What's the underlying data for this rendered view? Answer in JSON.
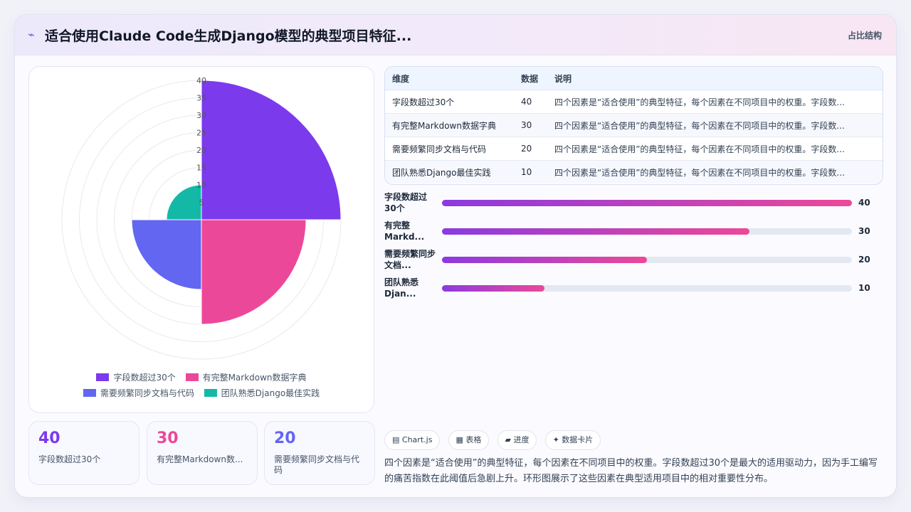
{
  "header": {
    "icon": "activity-icon",
    "title": "适合使用Claude Code生成Django模型的典型项目特征...",
    "tag": "占比结构"
  },
  "chart_data": {
    "type": "polarArea",
    "title": "",
    "categories": [
      "字段数超过30个",
      "有完整Markdown数据字典",
      "需要频繁同步文档与代码",
      "团队熟悉Django最佳实践"
    ],
    "values": [
      40,
      30,
      20,
      10
    ],
    "colors": [
      "#7c3aed",
      "#ec4899",
      "#6366f1",
      "#14b8a6"
    ],
    "rlim": [
      0,
      40
    ],
    "ticks": [
      40,
      35,
      30,
      25,
      20,
      15,
      10,
      5
    ],
    "grid": true,
    "legend": "bottom"
  },
  "legend": {
    "items": [
      {
        "label": "字段数超过30个",
        "color": "#7c3aed"
      },
      {
        "label": "有完整Markdown数据字典",
        "color": "#ec4899"
      },
      {
        "label": "需要频繁同步文档与代码",
        "color": "#6366f1"
      },
      {
        "label": "团队熟悉Django最佳实践",
        "color": "#14b8a6"
      }
    ]
  },
  "stats": [
    {
      "value": "40",
      "label": "字段数超过30个",
      "color": "#7c3aed"
    },
    {
      "value": "30",
      "label": "有完整Markdown数...",
      "color": "#ec4899"
    },
    {
      "value": "20",
      "label": "需要频繁同步文档与代码",
      "color": "#6366f1"
    }
  ],
  "table": {
    "headers": [
      "维度",
      "数据",
      "说明"
    ],
    "rows": [
      [
        "字段数超过30个",
        "40",
        "四个因素是“适合使用”的典型特征，每个因素在不同项目中的权重。字段数..."
      ],
      [
        "有完整Markdown数据字典",
        "30",
        "四个因素是“适合使用”的典型特征，每个因素在不同项目中的权重。字段数..."
      ],
      [
        "需要频繁同步文档与代码",
        "20",
        "四个因素是“适合使用”的典型特征，每个因素在不同项目中的权重。字段数..."
      ],
      [
        "团队熟悉Django最佳实践",
        "10",
        "四个因素是“适合使用”的典型特征，每个因素在不同项目中的权重。字段数..."
      ]
    ]
  },
  "bars": {
    "max": 40,
    "items": [
      {
        "label": "字段数超过30个",
        "value": 40,
        "display": "40"
      },
      {
        "label": "有完整Markd...",
        "value": 30,
        "display": "30"
      },
      {
        "label": "需要频繁同步文档...",
        "value": 20,
        "display": "20"
      },
      {
        "label": "团队熟悉Djan...",
        "value": 10,
        "display": "10"
      }
    ]
  },
  "chips": [
    {
      "icon": "▤",
      "label": "Chart.js"
    },
    {
      "icon": "▦",
      "label": "表格"
    },
    {
      "icon": "▰",
      "label": "进度"
    },
    {
      "icon": "✦",
      "label": "数据卡片"
    }
  ],
  "summary": "四个因素是“适合使用”的典型特征，每个因素在不同项目中的权重。字段数超过30个是最大的适用驱动力，因为手工编写的痛苦指数在此阈值后急剧上升。环形图展示了这些因素在典型适用项目中的相对重要性分布。"
}
